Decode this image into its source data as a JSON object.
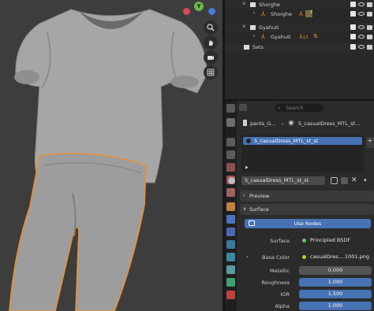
{
  "outliner": {
    "rows": [
      {
        "label": "Shorghe",
        "kind": "collection"
      },
      {
        "label": "Shorghe",
        "kind": "armature",
        "badge": "7"
      },
      {
        "label": "Gyahuti",
        "kind": "collection"
      },
      {
        "label": "Gyahuti",
        "kind": "armature",
        "badge": "13"
      },
      {
        "label": "Sets",
        "kind": "collection"
      }
    ]
  },
  "properties": {
    "search_placeholder": "Search",
    "breadcrumb_object": "pants_G...",
    "breadcrumb_material": "S_casualDress_MTL_st...",
    "slot_selected": "S_casualDress_MTL_st_st",
    "material_name": "S_casualDress_MTL_st_st",
    "preview_label": "Preview",
    "surface_label": "Surface",
    "use_nodes_label": "Use Nodes",
    "fields": [
      {
        "label": "Surface",
        "value": "Principled BSDF",
        "type": "shader"
      },
      {
        "label": "Base Color",
        "value": "casualDres....1001.png",
        "type": "texture"
      },
      {
        "label": "Metallic",
        "value": "0.000",
        "type": "number"
      },
      {
        "label": "Roughness",
        "value": "1.000",
        "type": "number"
      },
      {
        "label": "IOR",
        "value": "1.500",
        "type": "number"
      },
      {
        "label": "Alpha",
        "value": "1.000",
        "type": "number"
      }
    ]
  },
  "viewport": {
    "gizmo_y": "Y",
    "selection_color": "#e8913a",
    "mesh_color": "#a9a9a9"
  },
  "colors": {
    "accent": "#4772b3",
    "shader_dot": "#63c763",
    "texture_dot": "#c7c729"
  }
}
